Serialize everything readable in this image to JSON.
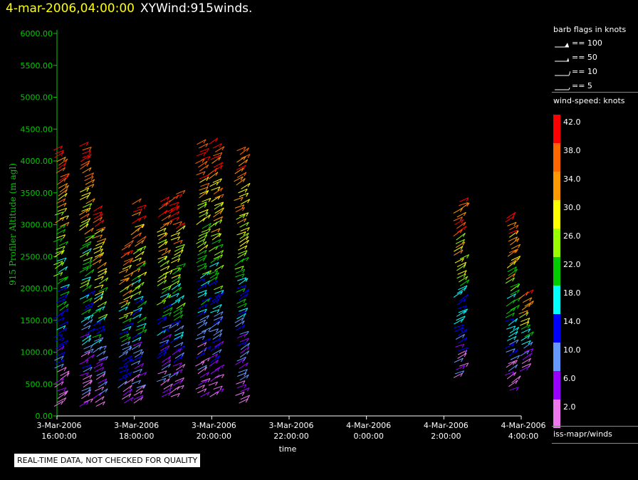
{
  "header": {
    "timestamp": "4-mar-2006,04:00:00",
    "plot_name": "XYWind:915winds."
  },
  "legend": {
    "barb_title": "barb flags in knots",
    "barb_items": [
      "== 100",
      "== 50",
      "== 10",
      "== 5"
    ],
    "colorbar_title": "wind-speed: knots",
    "colorbar": [
      {
        "label": "42.0",
        "color": "#ff0000"
      },
      {
        "label": "38.0",
        "color": "#ff6600"
      },
      {
        "label": "34.0",
        "color": "#ff9900"
      },
      {
        "label": "30.0",
        "color": "#ffff00"
      },
      {
        "label": "26.0",
        "color": "#99ff00"
      },
      {
        "label": "22.0",
        "color": "#00cc00"
      },
      {
        "label": "18.0",
        "color": "#00ffff"
      },
      {
        "label": "14.0",
        "color": "#0000ff"
      },
      {
        "label": "10.0",
        "color": "#6699ff"
      },
      {
        "label": "6.0",
        "color": "#9900ff"
      },
      {
        "label": "2.0",
        "color": "#ee77ee"
      }
    ],
    "source": "iss-mapr/winds"
  },
  "footnote": "REAL-TIME DATA, NOT CHECKED FOR QUALITY",
  "chart_data": {
    "type": "scatter",
    "ylabel": "915 Profiler Altitude (m agl)",
    "xlabel": "time",
    "ylim": [
      0,
      6000
    ],
    "yticks": [
      "0.00",
      "500.00",
      "1000.00",
      "1500.00",
      "2000.00",
      "2500.00",
      "3000.00",
      "3500.00",
      "4000.00",
      "4500.00",
      "5000.00",
      "5500.00",
      "6000.00"
    ],
    "xticks": [
      {
        "date": "3-Mar-2006",
        "time": "16:00:00"
      },
      {
        "date": "3-Mar-2006",
        "time": "18:00:00"
      },
      {
        "date": "3-Mar-2006",
        "time": "20:00:00"
      },
      {
        "date": "3-Mar-2006",
        "time": "22:00:00"
      },
      {
        "date": "4-Mar-2006",
        "time": "0:00:00"
      },
      {
        "date": "4-Mar-2006",
        "time": "2:00:00"
      },
      {
        "date": "4-Mar-2006",
        "time": "4:00:00"
      }
    ],
    "xlim": [
      "3-Mar-2006 16:00:00",
      "4-Mar-2006 04:00:00"
    ],
    "series": [
      {
        "x": "3-Mar-2006 16:00:00",
        "min_alt": 150,
        "max_alt": 4200
      },
      {
        "x": "3-Mar-2006 16:40:00",
        "min_alt": 150,
        "max_alt": 4250
      },
      {
        "x": "3-Mar-2006 17:00:00",
        "min_alt": 150,
        "max_alt": 3250
      },
      {
        "x": "3-Mar-2006 17:40:00",
        "min_alt": 200,
        "max_alt": 2700
      },
      {
        "x": "3-Mar-2006 18:00:00",
        "min_alt": 200,
        "max_alt": 3350
      },
      {
        "x": "3-Mar-2006 18:40:00",
        "min_alt": 300,
        "max_alt": 3400
      },
      {
        "x": "3-Mar-2006 19:00:00",
        "min_alt": 300,
        "max_alt": 3500
      },
      {
        "x": "3-Mar-2006 19:40:00",
        "min_alt": 300,
        "max_alt": 4300
      },
      {
        "x": "3-Mar-2006 20:00:00",
        "min_alt": 300,
        "max_alt": 4300
      },
      {
        "x": "3-Mar-2006 20:40:00",
        "min_alt": 200,
        "max_alt": 4200
      },
      {
        "x": "4-Mar-2006 02:20:00",
        "min_alt": 600,
        "max_alt": 3400
      },
      {
        "x": "4-Mar-2006 03:40:00",
        "min_alt": 400,
        "max_alt": 3150
      },
      {
        "x": "4-Mar-2006 04:00:00",
        "min_alt": 700,
        "max_alt": 1950
      }
    ]
  }
}
